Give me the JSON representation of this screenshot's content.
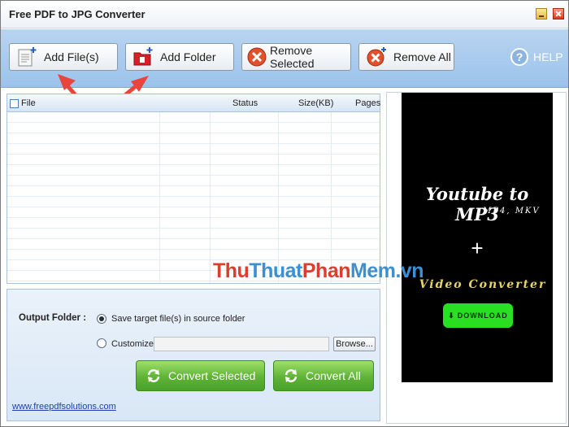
{
  "window": {
    "title": "Free PDF to JPG Converter"
  },
  "toolbar": {
    "add_files": "Add File(s)",
    "add_folder": "Add Folder",
    "remove_selected": "Remove Selected",
    "remove_all": "Remove All",
    "help": "HELP"
  },
  "file_list": {
    "columns": {
      "file": "File",
      "status": "Status",
      "size": "Size(KB)",
      "pages": "Pages"
    },
    "rows": []
  },
  "output": {
    "label": "Output Folder :",
    "option_source": "Save target file(s) in source folder",
    "option_customize": "Customize :",
    "selected": "source",
    "custom_path": "",
    "browse": "Browse...",
    "convert_selected": "Convert Selected",
    "convert_all": "Convert All",
    "website": "www.freepdfsolutions.com"
  },
  "ad": {
    "title": "Youtube to MP3",
    "subtitle": "MP4, MKV",
    "plus": "+",
    "video_converter": "Video Converter",
    "download": "DOWNLOAD"
  },
  "watermark": {
    "part1": "Thu",
    "part2": "Thuat",
    "part3": "Phan",
    "part4": "Mem.vn"
  },
  "colors": {
    "toolbar_bg": "#9cc3ec",
    "convert_green": "#5fb336",
    "arrow_red": "#e8453c",
    "link_blue": "#1a3fb0",
    "ad_bg": "#000000",
    "download_green": "#28e021"
  },
  "icons": {
    "add_files": "document-plus-icon",
    "add_folder": "folder-plus-icon",
    "remove": "remove-x-icon",
    "help": "question-icon",
    "convert": "refresh-arrows-icon"
  }
}
